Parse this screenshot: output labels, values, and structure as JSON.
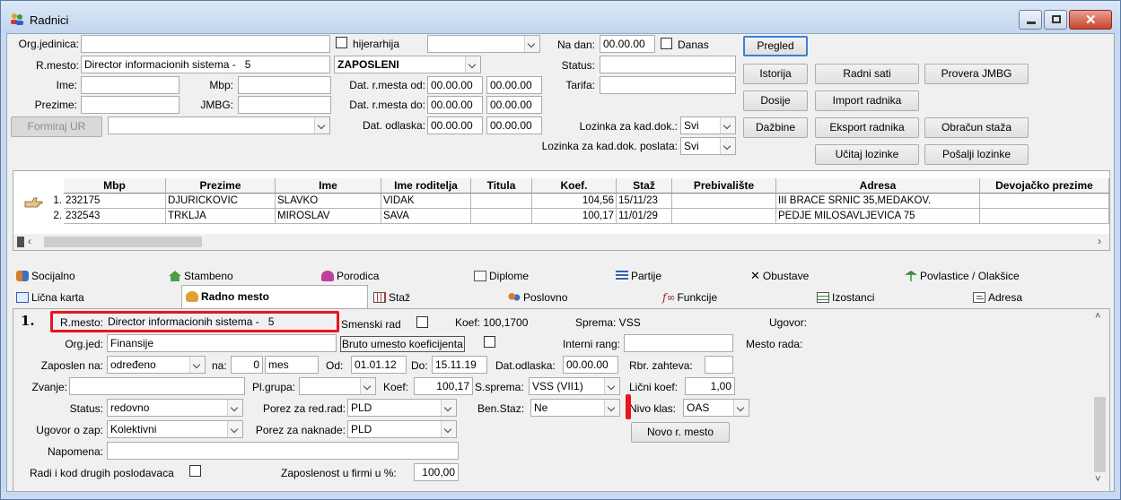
{
  "window": {
    "title": "Radnici"
  },
  "filters": {
    "org_jedinica_label": "Org.jedinica:",
    "org_jedinica_value": "",
    "hijerarhija_label": "hijerarhija",
    "hijerarhija_combo": "",
    "rmesto_label": "R.mesto:",
    "rmesto_value": "Director informacionih sistema -",
    "rmesto_num": "5",
    "zaposleni_combo": "ZAPOSLENI",
    "ime_label": "Ime:",
    "ime_value": "",
    "mbp_label": "Mbp:",
    "mbp_value": "",
    "prezime_label": "Prezime:",
    "prezime_value": "",
    "jmbg_label": "JMBG:",
    "jmbg_value": "",
    "dat_rmesta_od_label": "Dat. r.mesta od:",
    "dat_rmesta_od_1": "00.00.00",
    "dat_rmesta_od_2": "00.00.00",
    "dat_rmesta_do_label": "Dat. r.mesta do:",
    "dat_rmesta_do_1": "00.00.00",
    "dat_rmesta_do_2": "00.00.00",
    "dat_odlaska_label": "Dat. odlaska:",
    "dat_odlaska_1": "00.00.00",
    "dat_odlaska_2": "00.00.00",
    "formiraj_ur": "Formiraj UR",
    "formiraj_combo": "",
    "na_dan_label": "Na dan:",
    "na_dan_value": "00.00.00",
    "danas_label": "Danas",
    "status_label": "Status:",
    "status_value": "",
    "tarifa_label": "Tarifa:",
    "tarifa_value": "",
    "lozinka_label": "Lozinka za kad.dok.:",
    "lozinka_value": "Svi",
    "lozinka_poslata_label": "Lozinka za kad.dok. poslata:",
    "lozinka_poslata_value": "Svi"
  },
  "buttons": {
    "pregled": "Pregled",
    "istorija": "Istorija",
    "radni_sati": "Radni sati",
    "provera_jmbg": "Provera JMBG",
    "dosije": "Dosije",
    "import_radnika": "Import radnika",
    "dazbine": "Dažbine",
    "eksport_radnika": "Eksport radnika",
    "obracun_staza": "Obračun staža",
    "ucitaj_lozinke": "Učitaj lozinke",
    "posalji_lozinke": "Pošalji lozinke"
  },
  "grid": {
    "columns": [
      "Mbp",
      "Prezime",
      "Ime",
      "Ime roditelja",
      "Titula",
      "Koef.",
      "Staž",
      "Prebivalište",
      "Adresa",
      "Devojačko prezime"
    ],
    "rows": [
      {
        "no": "1.",
        "mbp": "232175",
        "prezime": "DJURICKOVIC",
        "ime": "SLAVKO",
        "roditelj": "VIDAK",
        "titula": "",
        "koef": "104,56",
        "staz": "15/11/23",
        "prebivaliste": "",
        "adresa": "III BRACE SRNIC 35,MEDAKOV.",
        "devojacko": ""
      },
      {
        "no": "2.",
        "mbp": "232543",
        "prezime": "TRKLJA",
        "ime": "MIROSLAV",
        "roditelj": "SAVA",
        "titula": "",
        "koef": "100,17",
        "staz": "11/01/29",
        "prebivaliste": "",
        "adresa": "PEDJE MILOSAVLJEVICA 75",
        "devojacko": ""
      }
    ]
  },
  "tabs_row1": [
    "Socijalno",
    "Stambeno",
    "Porodica",
    "Diplome",
    "Partije",
    "Obustave",
    "Povlastice / Olakšice"
  ],
  "tabs_row2": [
    "Lična karta",
    "Radno mesto",
    "Staž",
    "Poslovno",
    "Funkcije",
    "Izostanci",
    "Adresa"
  ],
  "detail": {
    "index": "1.",
    "rmesto_label": "R.mesto:",
    "rmesto_value": "Director informacionih sistema -",
    "rmesto_num": "5",
    "smenski_rad_label": "Smenski rad",
    "koef_info": "Koef: 100,1700",
    "sprema_info": "Sprema: VSS",
    "ugovor_label": "Ugovor:",
    "orgjed_label": "Org.jed:",
    "orgjed_value": "Finansije",
    "bruto_label": "Bruto umesto koeficijenta",
    "interni_rang_label": "Interni rang:",
    "interni_rang_value": "",
    "mesto_rada_label": "Mesto rada:",
    "zaposlen_na_label": "Zaposlen na:",
    "zaposlen_na_value": "određeno",
    "na_label": "na:",
    "na_value": "0",
    "na_unit": "mes",
    "od_label": "Od:",
    "od_value": "01.01.12",
    "do_label": "Do:",
    "do_value": "15.11.19",
    "dat_odlaska_label": "Dat.odlaska:",
    "dat_odlaska_value": "00.00.00",
    "rbr_zahteva_label": "Rbr. zahteva:",
    "rbr_zahteva_value": "",
    "zvanje_label": "Zvanje:",
    "zvanje_value": "",
    "plgrupa_label": "Pl.grupa:",
    "plgrupa_value": "",
    "koef_label": "Koef:",
    "koef_value": "100,17",
    "ssprema_label": "S.sprema:",
    "ssprema_value": "VSS (VII1)",
    "licni_koef_label": "Lični koef:",
    "licni_koef_value": "1,00",
    "status_label": "Status:",
    "status_value": "redovno",
    "porez_zarad_label": "Porez za red.rad:",
    "porez_zarad_value": "PLD",
    "benstaz_label": "Ben.Staz:",
    "benstaz_value": "Ne",
    "nivo_klas_label": "Nivo klas:",
    "nivo_klas_value": "OAS",
    "ugovor_zap_label": "Ugovor o zap:",
    "ugovor_zap_value": "Kolektivni",
    "porez_naknade_label": "Porez za naknade:",
    "porez_naknade_value": "PLD",
    "novo_rmesto": "Novo r. mesto",
    "napomena_label": "Napomena:",
    "napomena_value": "",
    "radi_drugih_label": "Radi i kod drugih poslodavaca",
    "zaposlenost_label": "Zaposlenost u firmi u %:",
    "zaposlenost_value": "100,00"
  }
}
